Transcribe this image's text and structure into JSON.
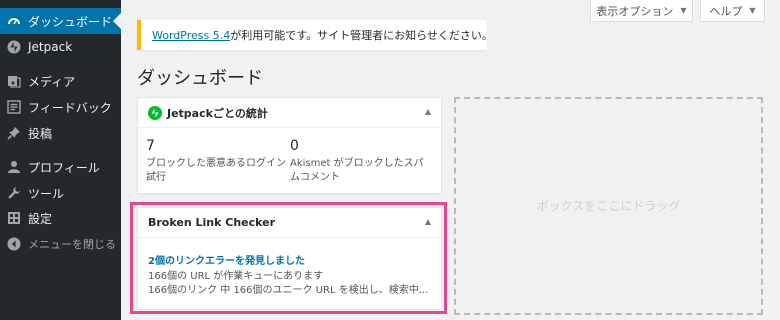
{
  "sidebar": {
    "items": [
      {
        "label": "ダッシュボード",
        "icon": "dashboard-icon"
      },
      {
        "label": "Jetpack",
        "icon": "jetpack-icon"
      },
      {
        "label": "メディア",
        "icon": "media-icon"
      },
      {
        "label": "フィードバック",
        "icon": "feedback-icon"
      },
      {
        "label": "投稿",
        "icon": "pin-icon"
      },
      {
        "label": "プロフィール",
        "icon": "user-icon"
      },
      {
        "label": "ツール",
        "icon": "wrench-icon"
      },
      {
        "label": "設定",
        "icon": "settings-icon"
      },
      {
        "label": "メニューを閉じる",
        "icon": "collapse-icon"
      }
    ]
  },
  "header": {
    "screen_options": "表示オプション",
    "help": "ヘルプ"
  },
  "notice": {
    "link": "WordPress 5.4",
    "text": " が利用可能です。サイト管理者にお知らせください。"
  },
  "page": {
    "title": "ダッシュボード"
  },
  "jetpack_box": {
    "title": "Jetpackごとの統計",
    "stats": [
      {
        "value": "7",
        "label": "ブロックした悪意あるログイン試行"
      },
      {
        "value": "0",
        "label": "Akismet がブロックしたスパムコメント"
      }
    ]
  },
  "blc_box": {
    "title": "Broken Link Checker",
    "link": "2個のリンクエラーを発見しました",
    "line1": "166個の URL が作業キューにあります",
    "line2": "166個のリンク 中 166個のユニーク URL を検出し、検索中..."
  },
  "dropzone": {
    "text": "ボックスをここにドラッグ"
  },
  "colors": {
    "sidebar_bg": "#23282d",
    "active_menu": "#0073aa",
    "notice_border": "#ffb900",
    "highlight": "#e44792",
    "jetpack_green": "#00be28"
  }
}
